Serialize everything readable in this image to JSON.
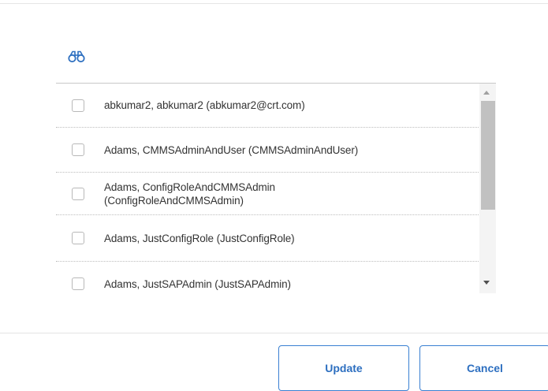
{
  "toolbar": {
    "search_icon": "binoculars-icon"
  },
  "users": [
    "abkumar2, abkumar2 (abkumar2@crt.com)",
    "Adams, CMMSAdminAndUser (CMMSAdminAndUser)",
    "Adams, ConfigRoleAndCMMSAdmin (ConfigRoleAndCMMSAdmin)",
    "Adams, JustConfigRole (JustConfigRole)",
    "Adams, JustSAPAdmin (JustSAPAdmin)"
  ],
  "footer": {
    "update_label": "Update",
    "cancel_label": "Cancel"
  },
  "colors": {
    "accent": "#2d6fc0",
    "border": "#3a80d2"
  }
}
